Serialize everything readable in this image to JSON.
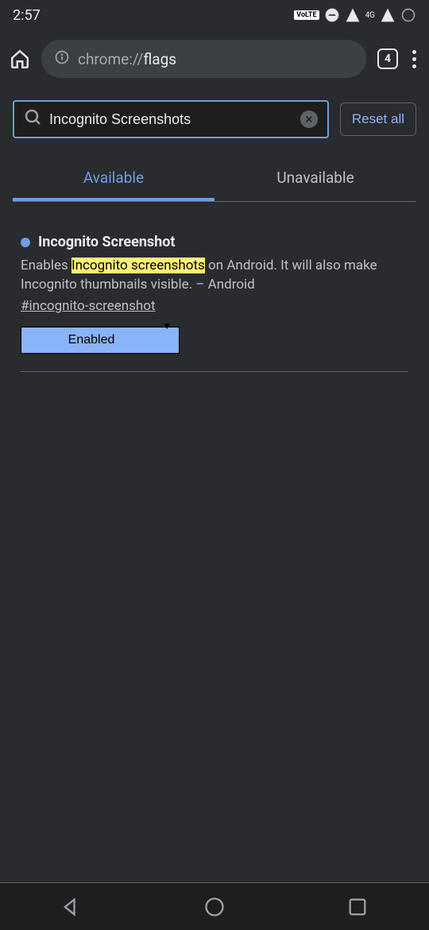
{
  "status_bar": {
    "time": "2:57",
    "volte": "VoLTE",
    "network_label": "4G"
  },
  "browser": {
    "url_scheme": "chrome://",
    "url_path": "flags",
    "tab_count": "4"
  },
  "search": {
    "value": "Incognito Screenshots",
    "reset_label": "Reset all"
  },
  "tabs": {
    "available": "Available",
    "unavailable": "Unavailable"
  },
  "flag": {
    "title": "Incognito Screenshot",
    "desc_pre": "Enables ",
    "desc_highlight": "Incognito screenshots",
    "desc_post": " on Android. It will also make Incognito thumbnails visible. – Android",
    "hash": "#incognito-screenshot",
    "selected": "Enabled"
  }
}
